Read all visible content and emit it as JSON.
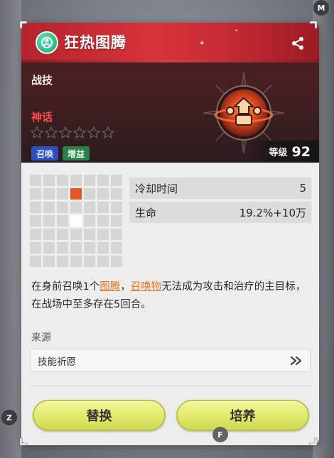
{
  "title": "狂热图腾",
  "skill_type": "战技",
  "rarity": "神话",
  "stars": {
    "filled": 0,
    "total": 6
  },
  "tags": [
    "召唤",
    "增益"
  ],
  "level": {
    "label": "等级",
    "value": "92"
  },
  "area_grid": {
    "cols": 7,
    "rows": 7,
    "highlight_orange": [
      [
        1,
        3
      ]
    ],
    "highlight_white": [
      [
        3,
        3
      ]
    ]
  },
  "stats": [
    {
      "label": "冷却时间",
      "value": "5"
    },
    {
      "label": "生命",
      "value": "19.2%+10万"
    }
  ],
  "description": {
    "part1": "在身前召唤1个",
    "link1": "图腾",
    "part2": "，",
    "link2": "召唤物",
    "part3": "无法成为攻击和治疗的主目标，在战场中至多存在5回合。"
  },
  "source": {
    "label": "来源",
    "item": "技能祈愿"
  },
  "buttons": {
    "replace": "替换",
    "upgrade": "培养"
  },
  "key_hints": {
    "top_right": "M",
    "bottom_left": "Z",
    "bottom_center": "F"
  },
  "colors": {
    "title_bar": "#d7323a",
    "rarity_text": "#ff4a4a",
    "highlight_text": "#e9731f",
    "button": "#e2eb6c",
    "grid_orange": "#e45622"
  }
}
